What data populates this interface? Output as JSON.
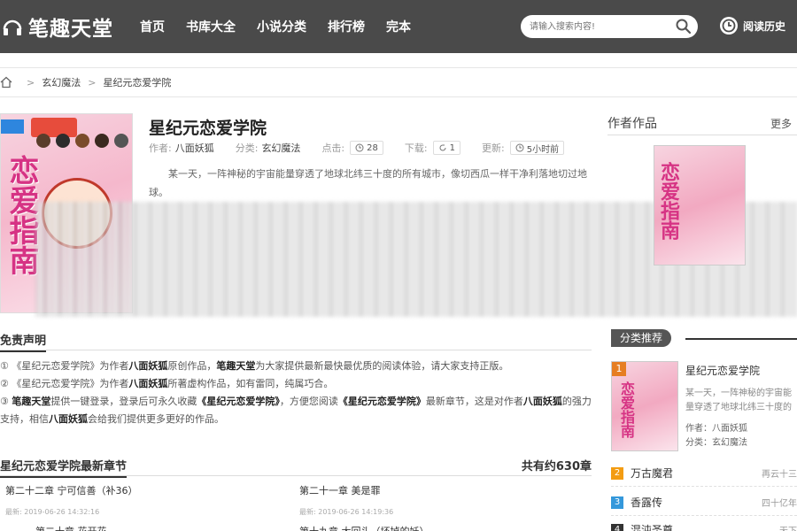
{
  "header": {
    "site_name": "笔趣天堂",
    "nav": [
      "首页",
      "书库大全",
      "小说分类",
      "排行榜",
      "完本"
    ],
    "search_placeholder": "请输入搜索内容!",
    "history_label": "阅读历史"
  },
  "breadcrumb": {
    "sep": ">",
    "category": "玄幻魔法",
    "book": "星纪元恋爱学院"
  },
  "book": {
    "title": "星纪元恋爱学院",
    "author_label": "作者:",
    "author": "八面妖狐",
    "category_label": "分类:",
    "category": "玄幻魔法",
    "clicks_label": "点击:",
    "clicks": "28",
    "downloads_label": "下载:",
    "downloads": "1",
    "updated_label": "更新:",
    "updated": "5小时前",
    "intro": "某一天，一阵神秘的宇宙能量穿透了地球北纬三十度的所有城市，像切西瓜一样干净利落地切过地球。",
    "cover_title": "恋爱指南",
    "cover_badge": "连载"
  },
  "sidebar": {
    "author_works_title": "作者作品",
    "more": "更多",
    "side_cover_title": "恋爱指南",
    "category_tab": "分类推荐",
    "rec": {
      "rank": "1",
      "name": "星纪元恋爱学院",
      "desc": "某一天，一阵神秘的宇宙能量穿透了地球北纬三十度的",
      "author_line": "作者：八面妖狐",
      "category_line": "分类：玄幻魔法",
      "cover_title": "恋爱指南"
    },
    "rank_list": [
      {
        "n": "2",
        "name": "万古魔君",
        "author": "再云十三",
        "color": "#f39c12"
      },
      {
        "n": "3",
        "name": "香露传",
        "author": "四十亿年",
        "color": "#3498db"
      },
      {
        "n": "4",
        "name": "混沌圣尊",
        "author": "天下",
        "color": "#333333"
      }
    ]
  },
  "disclaimer": {
    "title": "免责声明",
    "l1": {
      "mark": "①",
      "a": "《星纪元恋爱学院》为作者",
      "b": "八面妖狐",
      "c": "原创作品，",
      "d": "笔趣天堂",
      "e": "为大家提供最新最快最优质的阅读体验，请大家支持正版。"
    },
    "l2": {
      "mark": "②",
      "a": "《星纪元恋爱学院》为作者",
      "b": "八面妖狐",
      "c": "所著虚构作品，如有雷同，纯属巧合。"
    },
    "l3": {
      "mark": "③",
      "a": "笔趣天堂",
      "b": "提供一键登录，登录后可永久收藏",
      "c": "《星纪元恋爱学院》",
      "d": "，方便您阅读",
      "e": "《星纪元恋爱学院》",
      "f": "最新章节，这是对作者",
      "g": "八面妖狐",
      "h": "的强力支持，相信",
      "i": "八面妖狐",
      "j": "会给我们提供更多更好的作品。"
    }
  },
  "chapters": {
    "title": "星纪元恋爱学院最新章节",
    "count": "共有约630章",
    "items": [
      {
        "name": "第二十二章 宁可信善（补36）",
        "date": "最新: 2019-06-26 14:32:16"
      },
      {
        "name": "第二十一章 美是罪",
        "date": "最新: 2019-06-26 14:19:36"
      },
      {
        "name": "第二十章 花开花",
        "date": ""
      },
      {
        "name": "第十九章 大回头（坏掉的妖）",
        "date": ""
      }
    ]
  }
}
